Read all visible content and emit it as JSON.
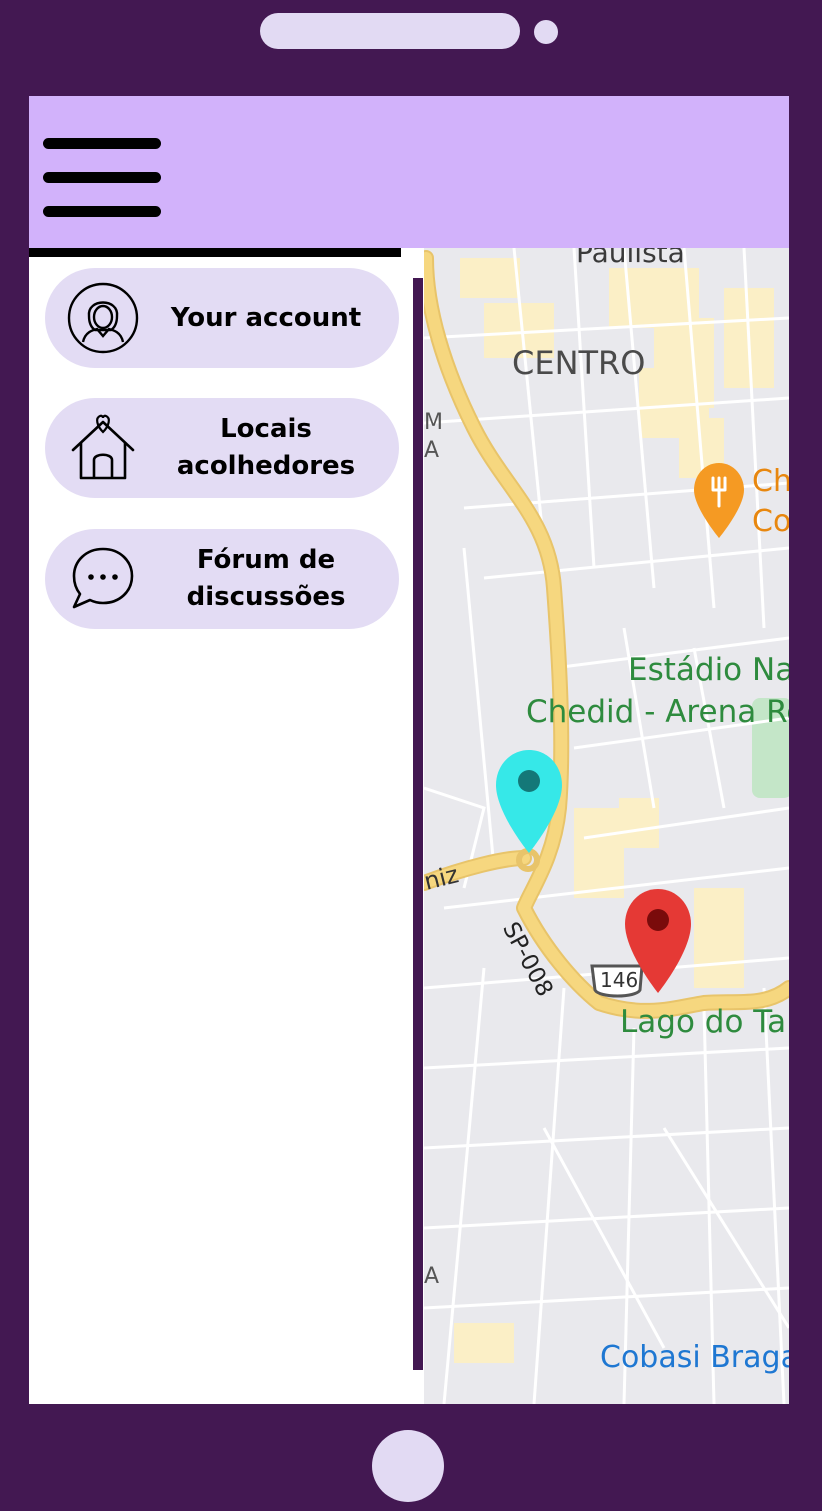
{
  "header": {
    "menu_button": "hamburger-menu"
  },
  "drawer": {
    "items": [
      {
        "label": "Your account",
        "icon": "user-avatar-icon"
      },
      {
        "label": "Locais\nacolhedores",
        "icon": "heart-home-icon"
      },
      {
        "label": "Fórum de\ndiscussões",
        "icon": "chat-bubble-icon"
      }
    ]
  },
  "map": {
    "labels": {
      "district_top": "Paulista",
      "district_center": "CENTRO",
      "stadium_line1": "Estádio Na",
      "stadium_line2": "Chedid - Arena Re",
      "road_sp": "SP-008",
      "shield": "146",
      "road_west": "niz",
      "lake": "Lago do Ta",
      "store": "Cobasi Braga",
      "poi_line1": "Ch",
      "poi_line2": "Co",
      "edge_m": "M",
      "edge_a": "A",
      "edge_a2": "A"
    },
    "markers": [
      {
        "name": "cyan-location-pin",
        "color": "#36e8e8"
      },
      {
        "name": "red-location-pin",
        "color": "#e53935"
      },
      {
        "name": "restaurant-pin",
        "color": "#f59a23"
      }
    ]
  },
  "colors": {
    "phone_frame": "#431852",
    "header_bg": "#d2b2fb",
    "menu_pill": "#e3dcf4",
    "map_bg": "#e9e9ed",
    "road_highlight": "#f6d77f",
    "park_green": "#c4e6c8",
    "label_green": "#2e8b3e",
    "label_blue": "#1e77d2",
    "label_orange": "#e8870f"
  }
}
